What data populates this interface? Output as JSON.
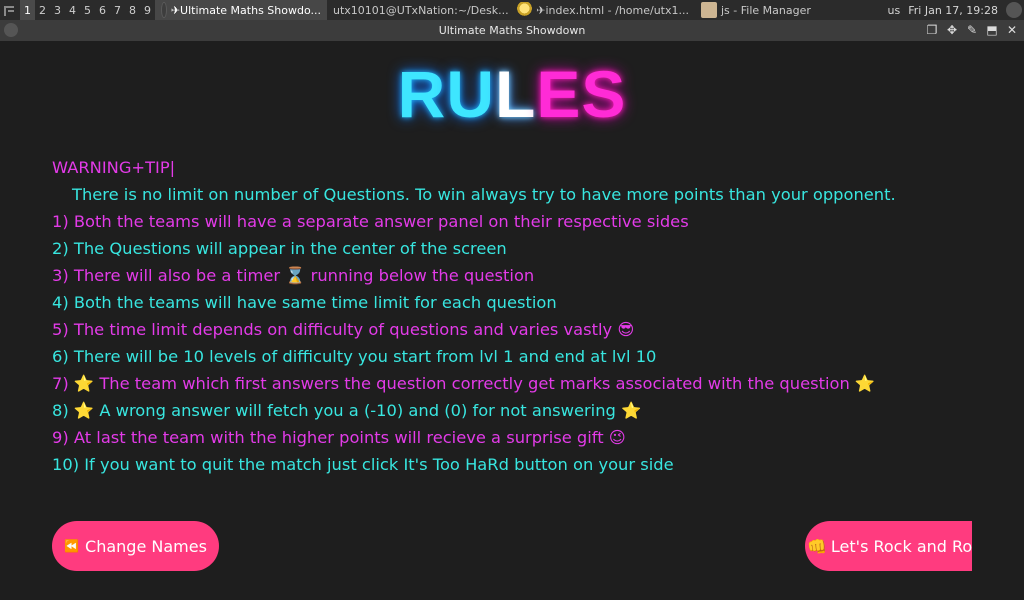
{
  "taskbar": {
    "workspaces": [
      "1",
      "2",
      "3",
      "4",
      "5",
      "6",
      "7",
      "8",
      "9"
    ],
    "active_workspace": "1",
    "tasks": [
      {
        "label": "✈Ultimate Maths Showdo...",
        "icon": "circle-icon",
        "active": true
      },
      {
        "label": "utx10101@UTxNation:~/Desk...",
        "icon": "terminal-icon",
        "active": false
      },
      {
        "label": "✈index.html - /home/utx1...",
        "icon": "trophy-icon",
        "active": false
      },
      {
        "label": "js - File Manager",
        "icon": "folder-icon",
        "active": false
      }
    ],
    "keyboard_layout": "us",
    "datetime": "Fri Jan 17, 19:28"
  },
  "window": {
    "title": "Ultimate Maths Showdown"
  },
  "page": {
    "heading": {
      "r": "R",
      "u": "U",
      "l": "L",
      "es": "ES"
    },
    "warning_label": "WARNING+TIP",
    "cursor": "|",
    "tip_text": "There is no limit on number of Questions. To win always try to have more points than your opponent.",
    "rules": [
      "1) Both the teams will have a separate answer panel on their respective sides",
      "2) The Questions will appear in the center of the screen",
      "3) There will also be a timer ⌛ running below the question",
      "4) Both the teams will have same time limit for each question",
      "5) The time limit depends on difficulty of questions and varies vastly 😎",
      "6) There will be 10 levels of difficulty you start from lvl 1 and end at lvl 10",
      "7) ⭐ The team which first answers the question correctly get marks associated with the question ⭐",
      "8) ⭐ A wrong answer will fetch you a (-10) and (0) for not answering ⭐",
      "9) At last the team with the higher points will recieve a surprise gift 😉",
      "10) If you want to quit the match just click It's Too HaRd button on your side"
    ],
    "change_names_icon": "⏪",
    "change_names_label": "Change Names",
    "rock_icon": "👊",
    "rock_label": "Let's Rock and Roll"
  },
  "colors": {
    "background": "#1e1e1e",
    "pink_text": "#e33be8",
    "cyan_text": "#38e6e0",
    "button": "#ff3b7f"
  }
}
